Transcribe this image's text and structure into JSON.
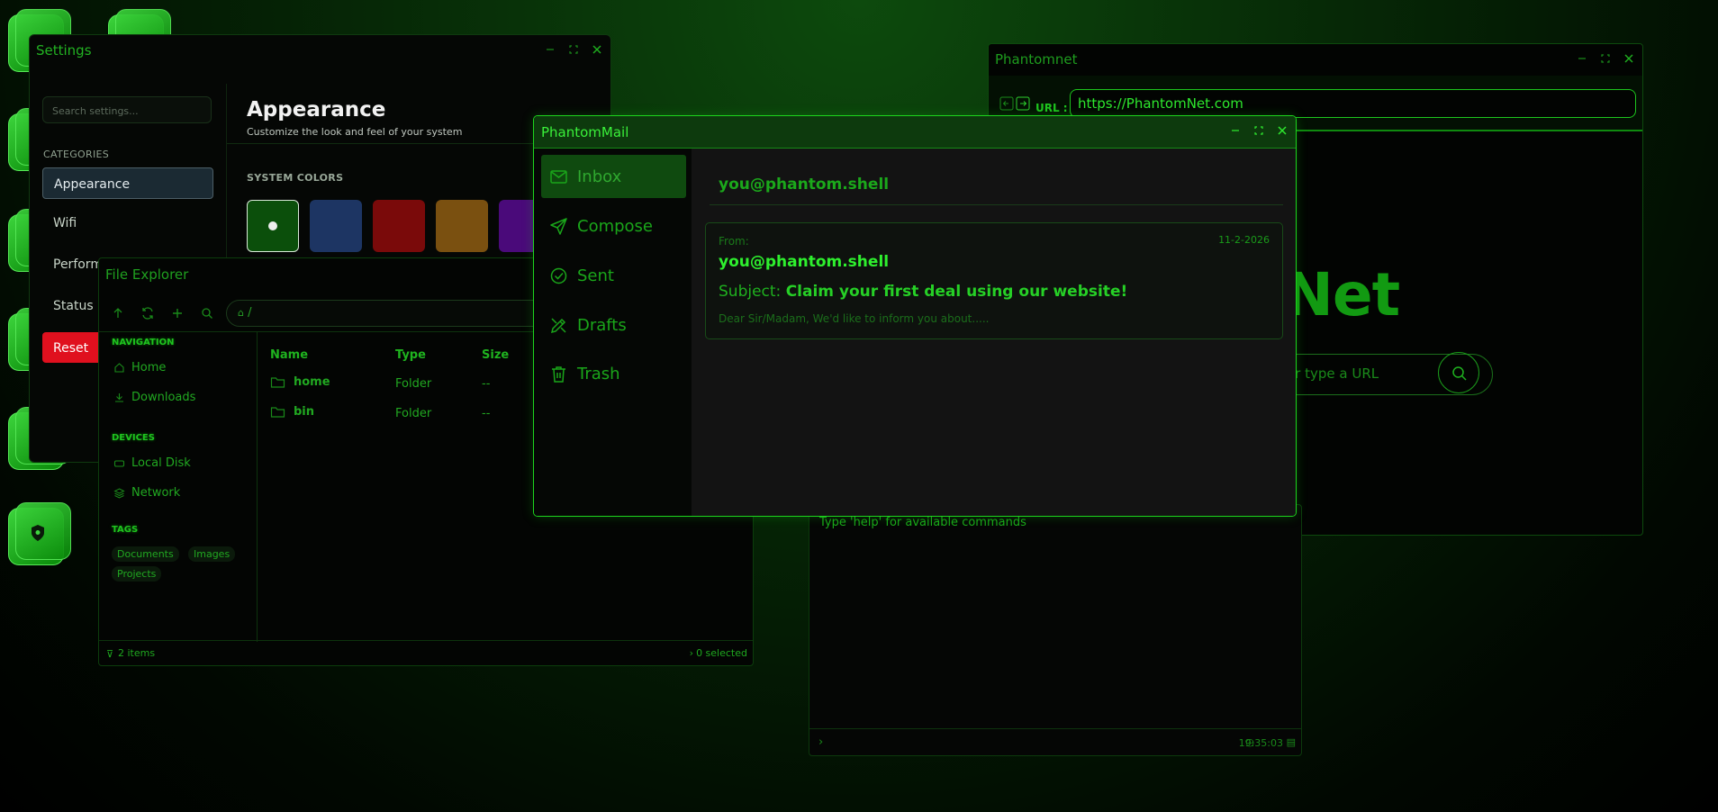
{
  "settings": {
    "title": "Settings",
    "search_placeholder": "Search settings...",
    "categories_label": "CATEGORIES",
    "items": [
      "Appearance",
      "Wifi",
      "Perform",
      "Status"
    ],
    "reset_label": "Reset",
    "heading": "Appearance",
    "subheading": "Customize the look and feel of your system",
    "system_colors_label": "SYSTEM COLORS",
    "colors": [
      "#0b4f0b",
      "#1d3563",
      "#7a0a0a",
      "#7a5010",
      "#4a0a7a"
    ]
  },
  "file_explorer": {
    "title": "File Explorer",
    "path": "/",
    "sections": {
      "navigation": "NAVIGATION",
      "devices": "DEVICES",
      "tags": "TAGS"
    },
    "nav_items": [
      "Home",
      "Downloads"
    ],
    "device_items": [
      "Local Disk",
      "Network"
    ],
    "tags": [
      "Documents",
      "Images",
      "Projects"
    ],
    "columns": [
      "Name",
      "Type",
      "Size"
    ],
    "rows": [
      {
        "name": "home",
        "type": "Folder",
        "size": "--"
      },
      {
        "name": "bin",
        "type": "Folder",
        "size": "--"
      }
    ],
    "status_items": "2 items",
    "status_selected": "0 selected"
  },
  "browser": {
    "title": "Phantomnet",
    "url_label": "URL :",
    "url": "https://PhantomNet.com",
    "logo_text": "tomNet",
    "search_placeholder": "or type a URL"
  },
  "terminal": {
    "hint": "Type 'help' for available commands",
    "time": "19:35:03"
  },
  "mail": {
    "title": "PhantomMail",
    "nav": [
      "Inbox",
      "Compose",
      "Sent",
      "Drafts",
      "Trash"
    ],
    "account": "you@phantom.shell",
    "message": {
      "from_label": "From:",
      "date": "11-2-2026",
      "from": "you@phantom.shell",
      "subject_label": "Subject:",
      "subject": "Claim your first deal using our website!",
      "preview": "Dear Sir/Madam, We'd like to inform you about....."
    }
  },
  "colors": {
    "accent": "#1dd41d",
    "reset": "#e0101e"
  }
}
